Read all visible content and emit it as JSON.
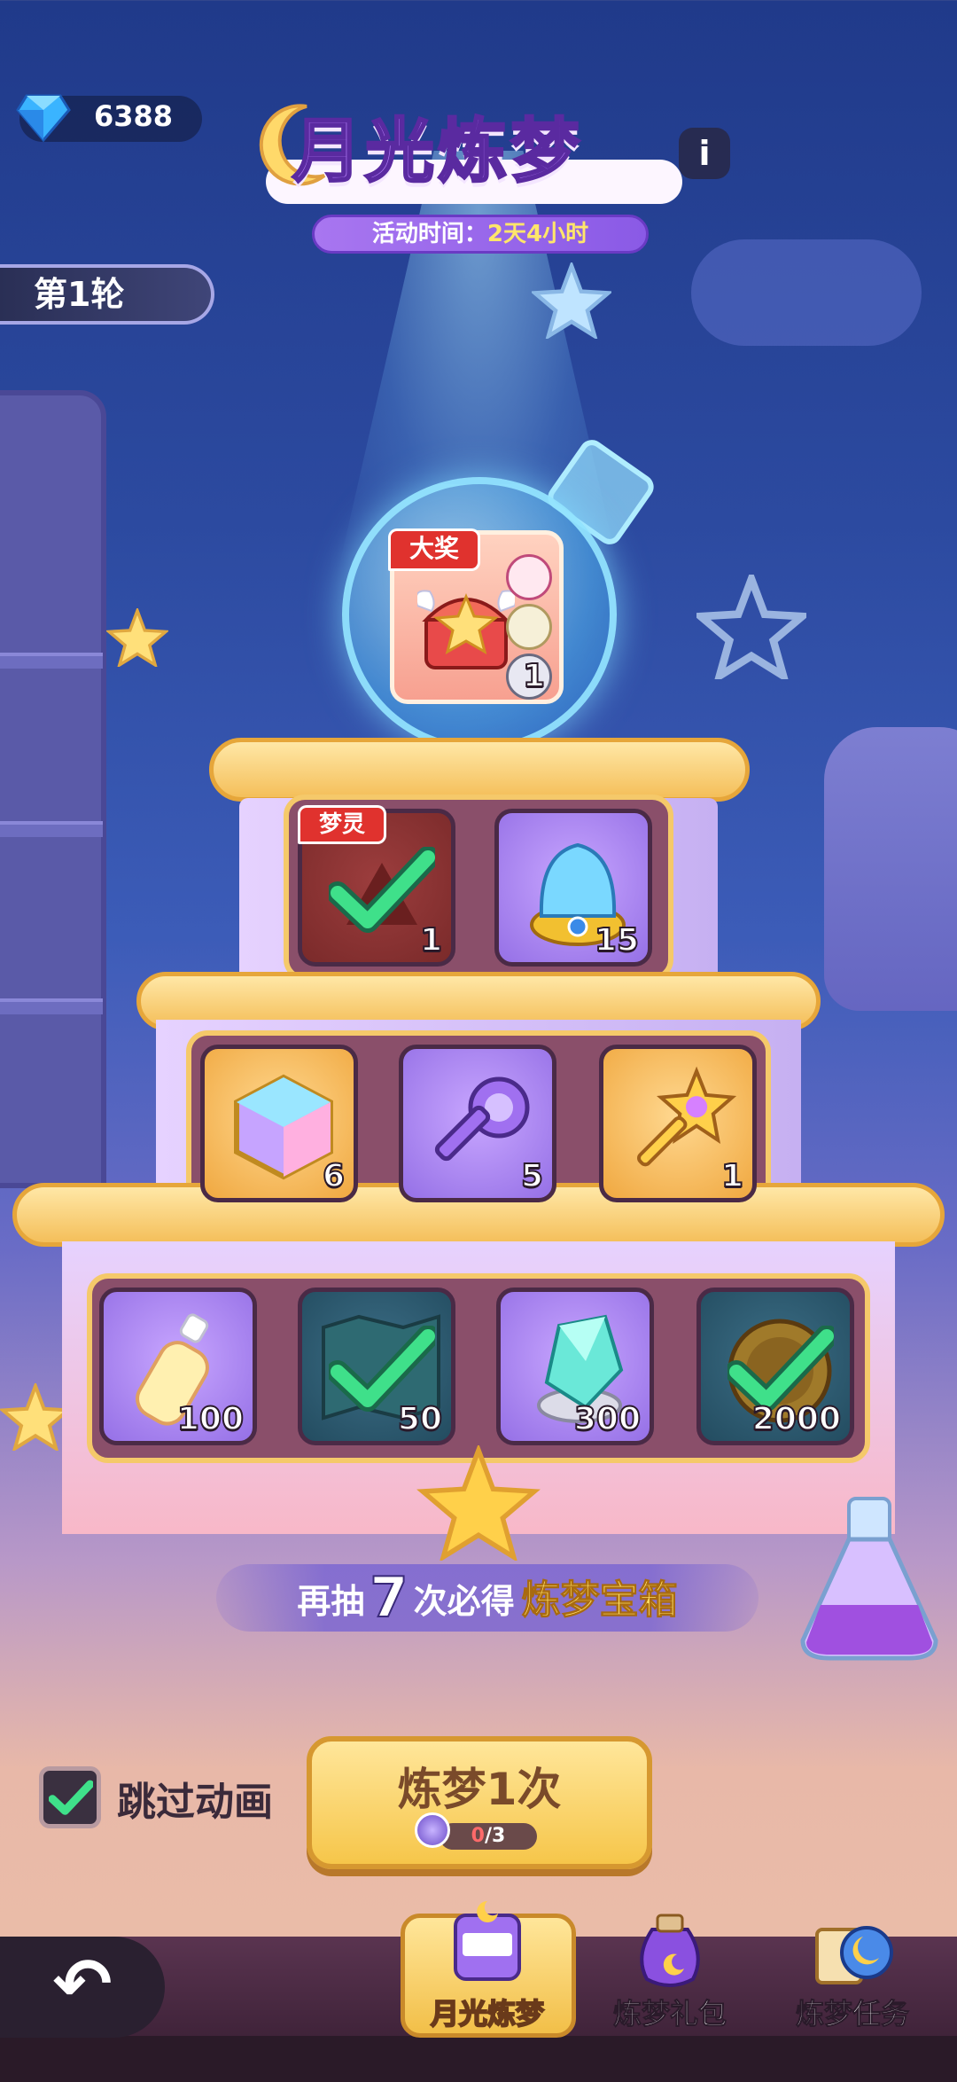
{
  "header": {
    "currency_value": "6388",
    "title": "月光炼梦",
    "time_label": "活动时间：",
    "time_value": "2天4小时",
    "round_label": "第1轮"
  },
  "grand_prize": {
    "badge": "大奖",
    "quantity": "1"
  },
  "tiers": [
    {
      "items": [
        {
          "badge": "梦灵",
          "quantity": "1",
          "claimed": true,
          "icon": "dream-spirit-icon"
        },
        {
          "quantity": "15",
          "claimed": false,
          "icon": "spirit-helmet-icon"
        }
      ]
    },
    {
      "items": [
        {
          "quantity": "6",
          "claimed": false,
          "icon": "rainbow-cube-icon"
        },
        {
          "quantity": "5",
          "claimed": false,
          "icon": "purple-key-icon"
        },
        {
          "quantity": "1",
          "claimed": false,
          "icon": "star-key-icon"
        }
      ]
    },
    {
      "items": [
        {
          "quantity": "100",
          "claimed": false,
          "icon": "rainbow-bottle-icon"
        },
        {
          "quantity": "50",
          "claimed": true,
          "icon": "map-icon"
        },
        {
          "quantity": "300",
          "claimed": false,
          "icon": "crystal-icon"
        },
        {
          "quantity": "2000",
          "claimed": true,
          "icon": "gold-coin-icon"
        }
      ]
    }
  ],
  "guarantee": {
    "prefix": "再抽",
    "count": "7",
    "middle": "次必得",
    "prize": "炼梦宝箱"
  },
  "controls": {
    "skip_label": "跳过动画",
    "skip_checked": true,
    "draw_label": "炼梦1次",
    "cost_have": "0",
    "cost_total": "/3"
  },
  "nav": {
    "tabs": [
      {
        "label": "月光炼梦",
        "active": true,
        "icon": "slot-machine-icon"
      },
      {
        "label": "炼梦礼包",
        "active": false,
        "icon": "potion-bag-icon"
      },
      {
        "label": "炼梦任务",
        "active": false,
        "icon": "scroll-moon-icon"
      }
    ]
  },
  "colors": {
    "accent_purple": "#b27cf7",
    "gold": "#f6c64a",
    "badge_red": "#e0322e",
    "check_green": "#3fe08a"
  }
}
